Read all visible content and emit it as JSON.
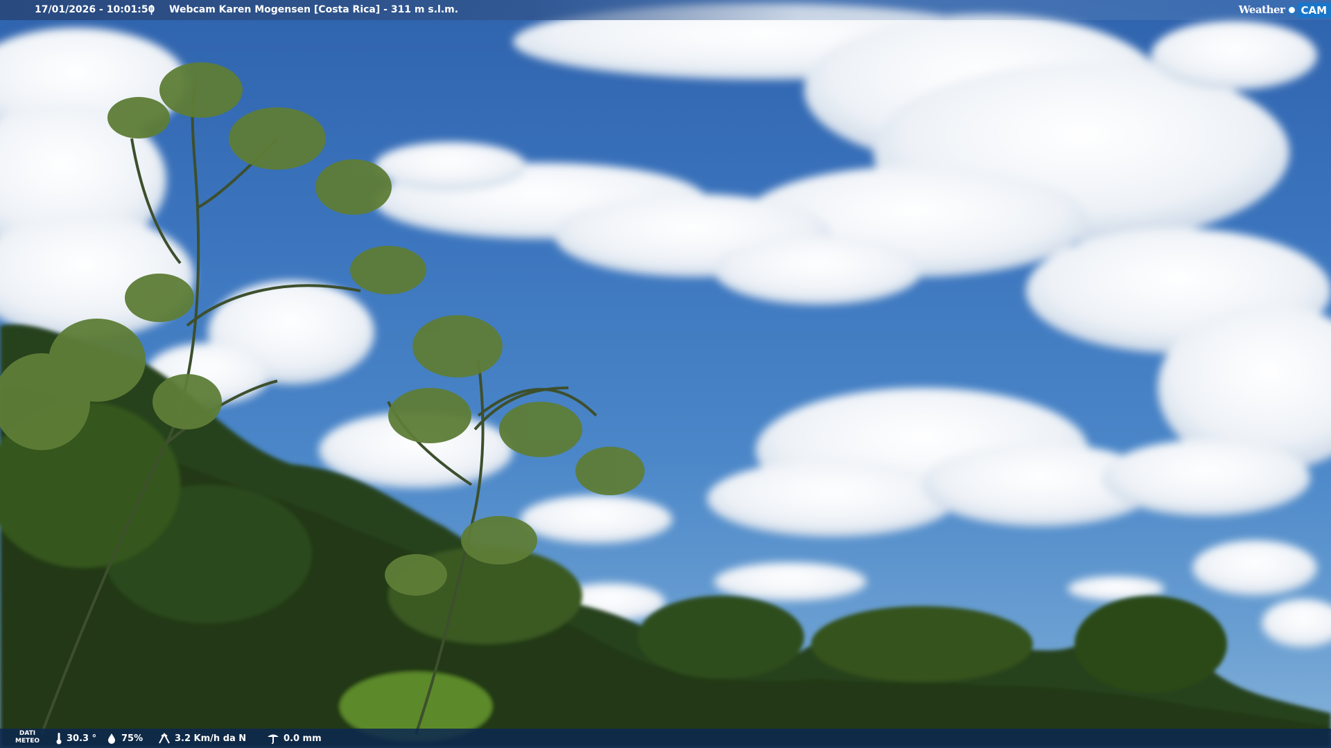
{
  "overlay_top": {
    "timestamp": "17/01/2026 - 10:01:50",
    "separator": "|",
    "camera_title": "Webcam Karen Mogensen [Costa Rica] - 311 m s.l.m.",
    "brand": {
      "part_a": "Weather",
      "part_b": "CAM",
      "color": "#1a76c9"
    }
  },
  "overlay_bottom": {
    "label_line1": "DATI",
    "label_line2": "METEO",
    "temperature": "30.3 °",
    "humidity": "75%",
    "wind": "3.2 Km/h da N",
    "rain": "0.0 mm",
    "icons": [
      "thermometer-icon",
      "humidity-drop-icon",
      "wind-icon",
      "rain-gauge-icon"
    ]
  },
  "scene": {
    "sky_color": "#3b74bd",
    "cloud_color": "#f2f5f9",
    "vegetation_color": "#2e4a1f"
  }
}
